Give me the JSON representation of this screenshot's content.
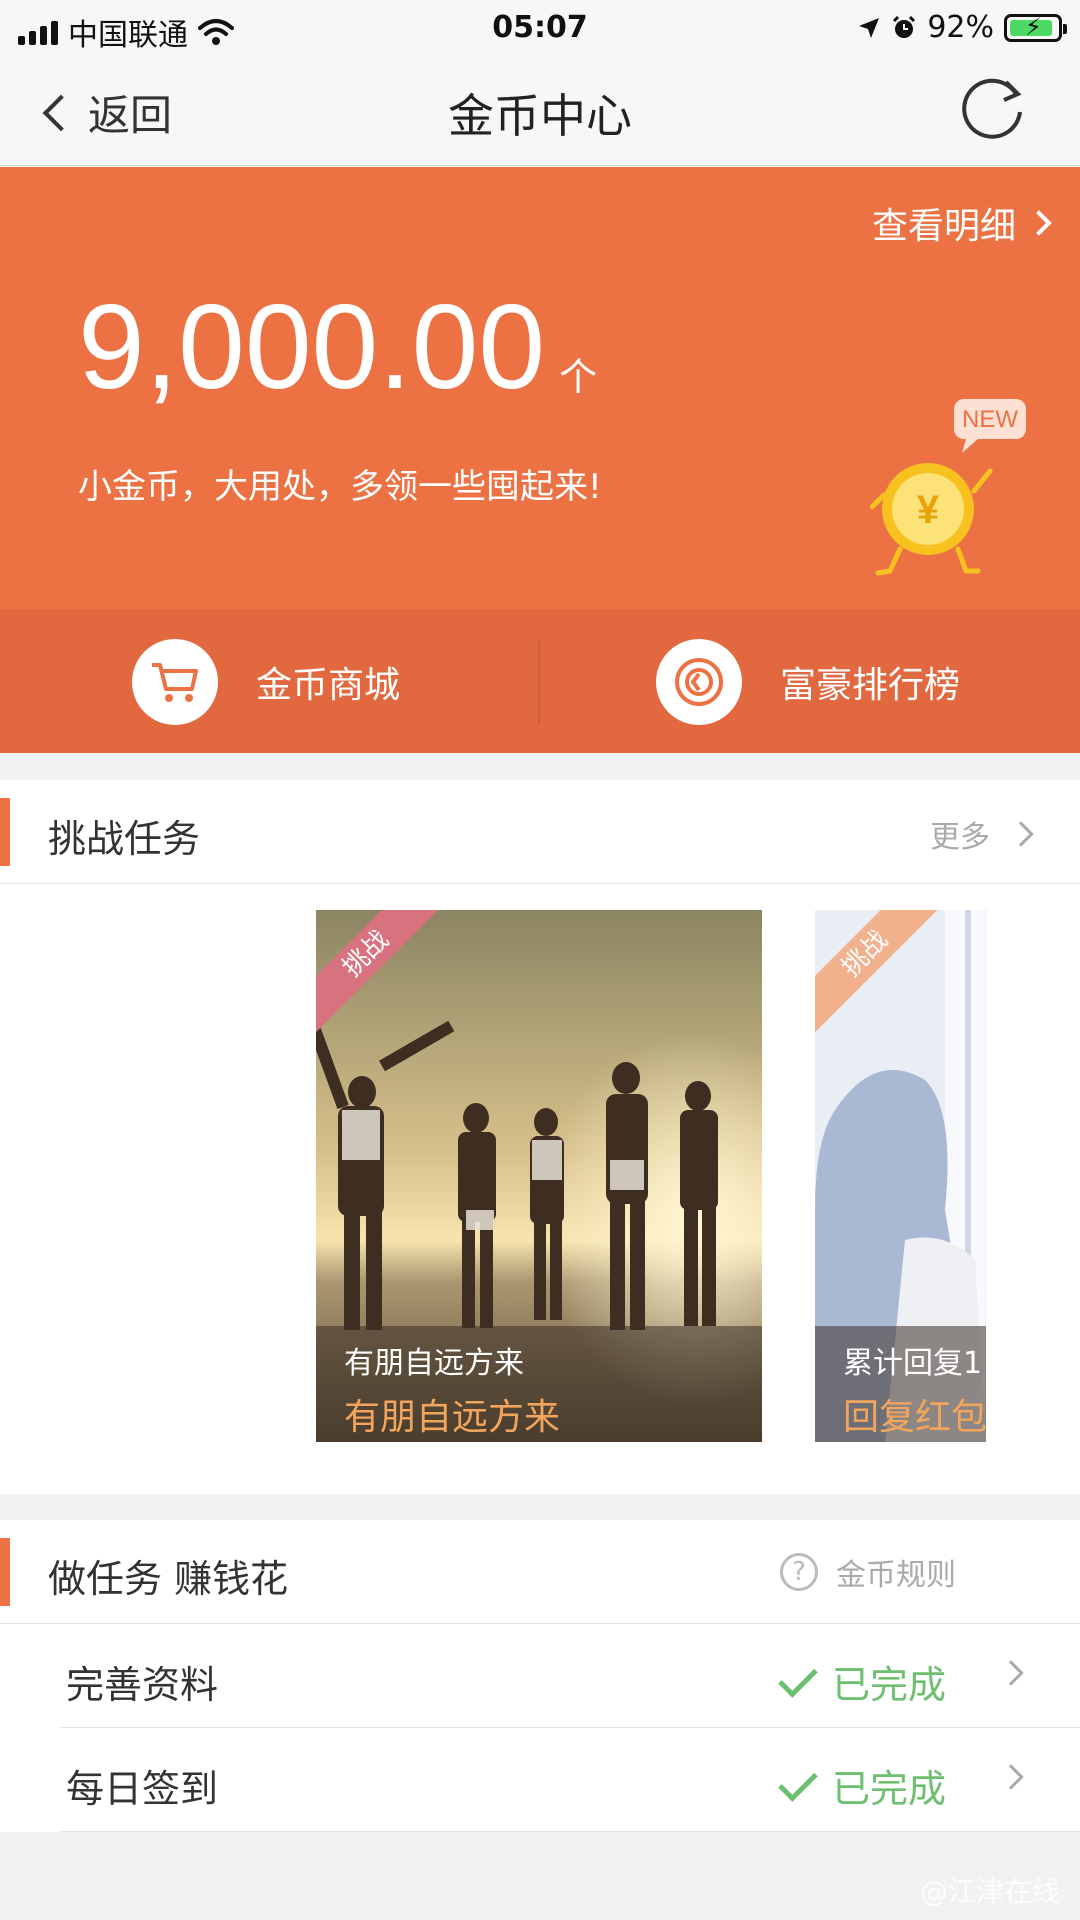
{
  "status_bar": {
    "carrier": "中国联通",
    "time": "05:07",
    "battery": "92%"
  },
  "nav": {
    "back_label": "返回",
    "title": "金币中心"
  },
  "hero": {
    "detail_link": "查看明细",
    "balance": "9,000.00",
    "unit": "个",
    "slogan": "小金币，大用处，多领一些囤起来!",
    "badge": "NEW",
    "coin_symbol": "¥"
  },
  "actions": [
    {
      "label": "金币商城",
      "icon": "cart-icon"
    },
    {
      "label": "富豪排行榜",
      "icon": "coin-rank-icon"
    }
  ],
  "challenge": {
    "title": "挑战任务",
    "more": "更多",
    "cards": [
      {
        "tag": "挑战",
        "line1": "有朋自远方来",
        "line2": "有朋自远方来"
      },
      {
        "tag": "挑战",
        "line1": "累计回复1",
        "line2": "回复红包"
      }
    ]
  },
  "tasks": {
    "title": "做任务 赚钱花",
    "rules": "金币规则",
    "items": [
      {
        "label": "完善资料",
        "status": "已完成"
      },
      {
        "label": "每日签到",
        "status": "已完成"
      }
    ]
  },
  "watermark": "@江津在线",
  "colors": {
    "accent": "#ec7244",
    "accent_dark": "#e2693f",
    "done_green": "#6cc070"
  }
}
